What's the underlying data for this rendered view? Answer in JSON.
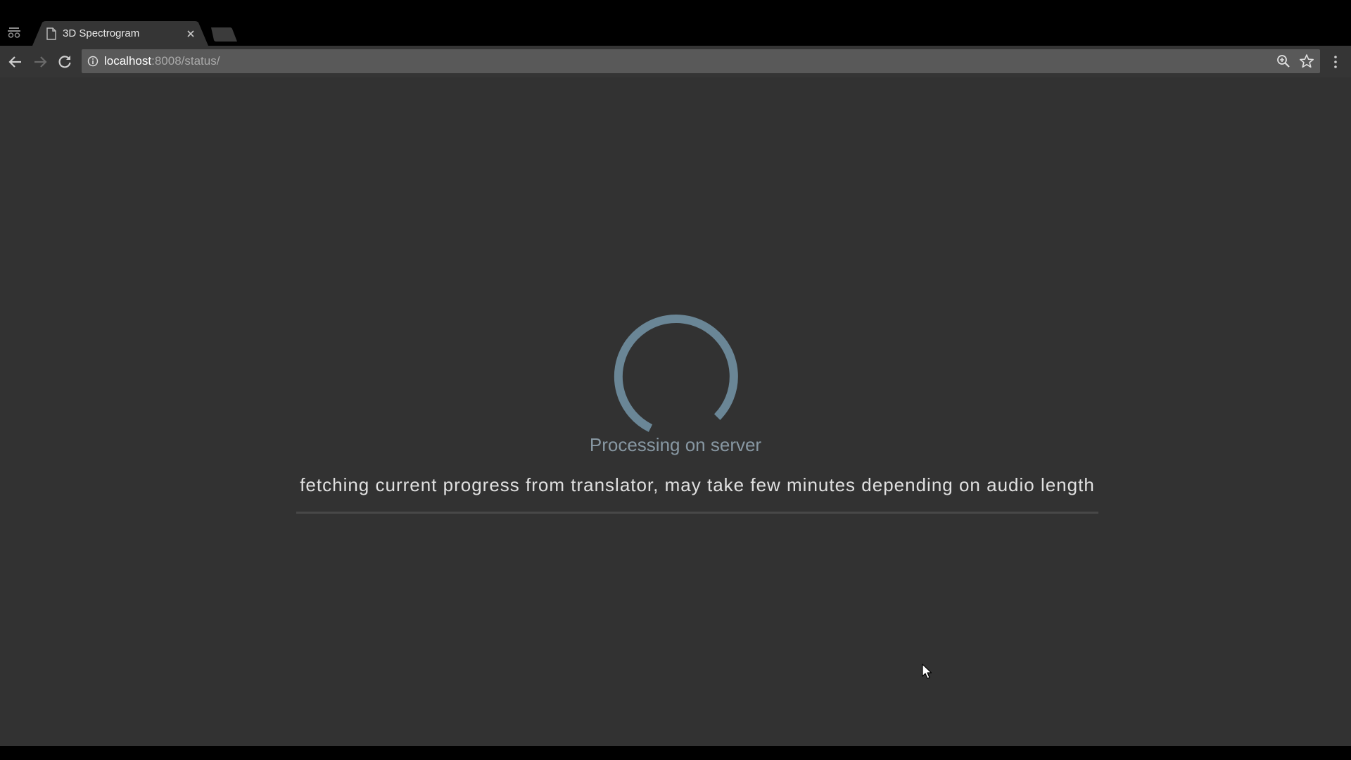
{
  "browser": {
    "tab": {
      "title": "3D Spectrogram",
      "favicon": "page-icon",
      "close_icon": "close-icon"
    },
    "new_tab_icon": "new-tab-icon",
    "tab_search_icon": "tab-search-icon",
    "toolbar": {
      "back_icon": "arrow-left-icon",
      "forward_icon": "arrow-right-icon",
      "reload_icon": "reload-icon",
      "menu_icon": "kebab-menu-icon"
    },
    "omnibox": {
      "info_icon": "info-icon",
      "url_host": "localhost",
      "url_rest": ":8008/status/",
      "zoom_icon": "zoom-icon",
      "bookmark_icon": "star-icon"
    }
  },
  "page": {
    "background_color": "#323232",
    "accent_color": "#6a8696",
    "spinner_icon": "loading-spinner",
    "status_title": "Processing on server",
    "status_message": "fetching current progress from translator, may take few minutes depending on audio length",
    "progress": 0
  },
  "cursor": "mouse-pointer-icon"
}
